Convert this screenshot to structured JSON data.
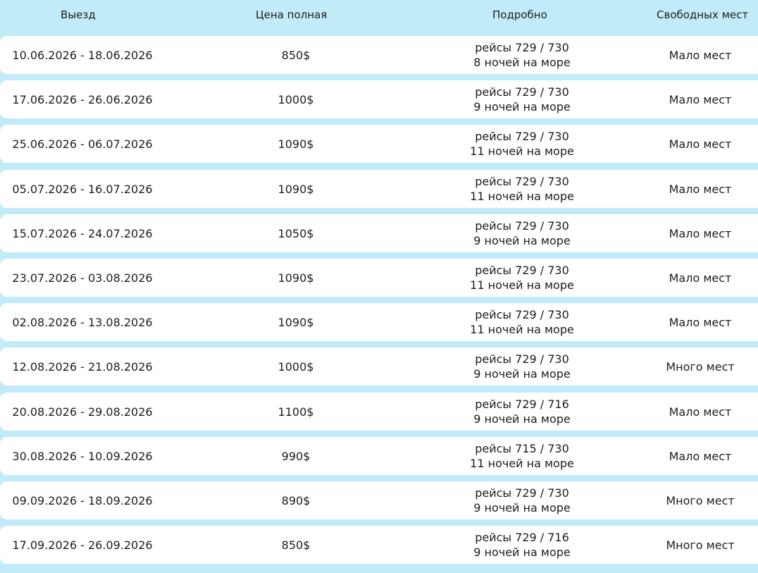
{
  "headers": {
    "departure": "Выезд",
    "price": "Цена полная",
    "details": "Подробно",
    "seats": "Свободных мест"
  },
  "rows": [
    {
      "dates": "10.06.2026 - 18.06.2026",
      "price": "850$",
      "flights": "рейсы 729 / 730",
      "nights": "8 ночей на море",
      "seats": "Мало мест"
    },
    {
      "dates": "17.06.2026 - 26.06.2026",
      "price": "1000$",
      "flights": "рейсы 729 / 730",
      "nights": "9 ночей на море",
      "seats": "Мало мест"
    },
    {
      "dates": "25.06.2026 - 06.07.2026",
      "price": "1090$",
      "flights": "рейсы 729 / 730",
      "nights": "11 ночей на море",
      "seats": "Мало мест"
    },
    {
      "dates": "05.07.2026 - 16.07.2026",
      "price": "1090$",
      "flights": "рейсы 729 / 730",
      "nights": "11 ночей на море",
      "seats": "Мало мест"
    },
    {
      "dates": "15.07.2026 - 24.07.2026",
      "price": "1050$",
      "flights": "рейсы 729 / 730",
      "nights": "9 ночей на море",
      "seats": "Мало мест"
    },
    {
      "dates": "23.07.2026 - 03.08.2026",
      "price": "1090$",
      "flights": "рейсы 729 / 730",
      "nights": "11 ночей на море",
      "seats": "Мало мест"
    },
    {
      "dates": "02.08.2026 - 13.08.2026",
      "price": "1090$",
      "flights": "рейсы 729 / 730",
      "nights": "11 ночей на море",
      "seats": "Мало мест"
    },
    {
      "dates": "12.08.2026 - 21.08.2026",
      "price": "1000$",
      "flights": "рейсы 729 / 730",
      "nights": "9 ночей на море",
      "seats": "Много мест"
    },
    {
      "dates": "20.08.2026 - 29.08.2026",
      "price": "1100$",
      "flights": "рейсы 729 / 716",
      "nights": "9 ночей на море",
      "seats": "Мало мест"
    },
    {
      "dates": "30.08.2026 - 10.09.2026",
      "price": "990$",
      "flights": "рейсы 715 / 730",
      "nights": "11 ночей на море",
      "seats": "Мало мест"
    },
    {
      "dates": "09.09.2026 - 18.09.2026",
      "price": "890$",
      "flights": "рейсы 729 / 730",
      "nights": "9 ночей на море",
      "seats": "Много мест"
    },
    {
      "dates": "17.09.2026 - 26.09.2026",
      "price": "850$",
      "flights": "рейсы 729 / 716",
      "nights": "9 ночей на море",
      "seats": "Много мест"
    }
  ],
  "colors": {
    "band": "#c2ebf9",
    "row_bg": "#ffffff",
    "text": "#1c1c1c"
  }
}
